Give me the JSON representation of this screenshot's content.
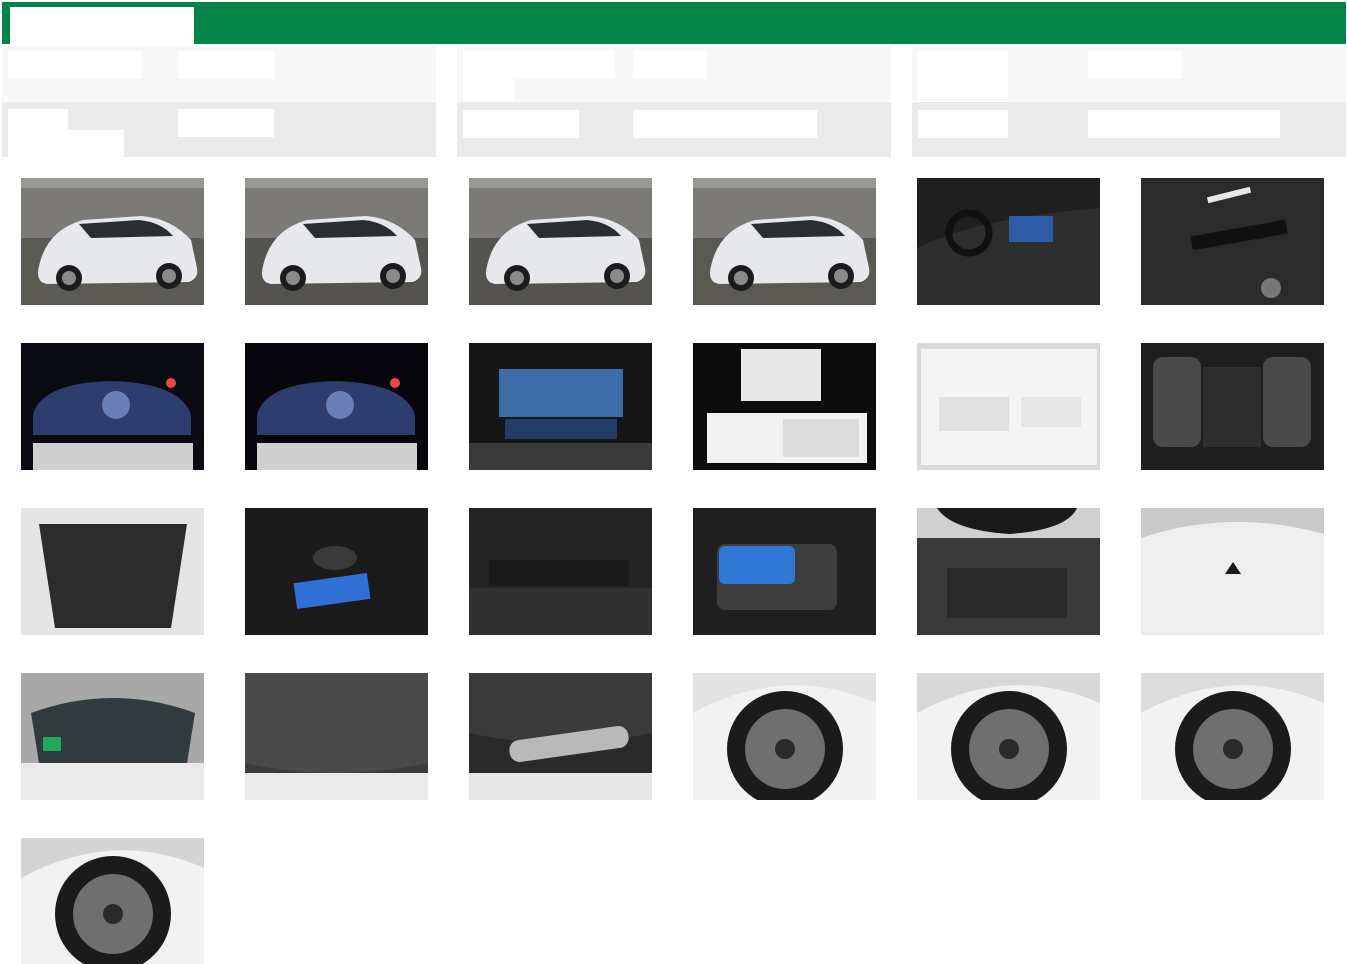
{
  "header": {
    "brand_color": "#028449",
    "tab_label": ""
  },
  "info_panels": [
    {
      "rows": [
        {
          "label": "",
          "value": ""
        },
        {
          "label": "",
          "value": ""
        }
      ]
    },
    {
      "rows": [
        {
          "label": "",
          "value": ""
        },
        {
          "label": "",
          "value": ""
        }
      ]
    },
    {
      "rows": [
        {
          "label": "",
          "value": ""
        },
        {
          "label": "",
          "value": ""
        }
      ]
    }
  ],
  "gallery": {
    "photos": [
      {
        "icon": "car-front-left-photo",
        "kind": "ext",
        "bg": "#5c5a55"
      },
      {
        "icon": "car-front-right-photo",
        "kind": "ext",
        "bg": "#55534f"
      },
      {
        "icon": "car-rear-left-photo",
        "kind": "ext",
        "bg": "#55534f"
      },
      {
        "icon": "car-rear-right-photo",
        "kind": "ext",
        "bg": "#5a5853"
      },
      {
        "icon": "dashboard-interior-photo",
        "kind": "interior",
        "bg": "#1f1f1f"
      },
      {
        "icon": "vin-plate-photo",
        "kind": "vin",
        "bg": "#2b2b2b"
      },
      {
        "icon": "instrument-cluster-photo",
        "kind": "cluster",
        "bg": "#0a0a12"
      },
      {
        "icon": "instrument-cluster-closeup-photo",
        "kind": "cluster",
        "bg": "#06060c"
      },
      {
        "icon": "infotainment-screen-photo",
        "kind": "screen",
        "bg": "#161616"
      },
      {
        "icon": "owner-manual-photo",
        "kind": "manual",
        "bg": "#0c0c0c"
      },
      {
        "icon": "service-book-photo",
        "kind": "book",
        "bg": "#d9d9d9"
      },
      {
        "icon": "rear-seats-photo",
        "kind": "seats",
        "bg": "#1e1e1e"
      },
      {
        "icon": "trunk-open-photo",
        "kind": "trunk",
        "bg": "#2d2d2d"
      },
      {
        "icon": "trunk-floor-repair-kit-photo",
        "kind": "trunkfloor",
        "bg": "#1b1b1b"
      },
      {
        "icon": "trunk-side-compartment-photo",
        "kind": "trunkside",
        "bg": "#242424"
      },
      {
        "icon": "charging-cable-bag-photo",
        "kind": "bag",
        "bg": "#1f1f1f"
      },
      {
        "icon": "engine-bay-photo",
        "kind": "engine",
        "bg": "#3a3a3a"
      },
      {
        "icon": "roof-antenna-photo",
        "kind": "roof",
        "bg": "#c9c9c9"
      },
      {
        "icon": "windshield-photo",
        "kind": "windshield",
        "bg": "#a8a8a8"
      },
      {
        "icon": "underbody-front-photo",
        "kind": "underbody",
        "bg": "#3c3c3c"
      },
      {
        "icon": "underbody-exhaust-photo",
        "kind": "exhaust",
        "bg": "#2a2a2a"
      },
      {
        "icon": "wheel-front-left-photo",
        "kind": "wheel",
        "bg": "#e2e2e2"
      },
      {
        "icon": "wheel-rear-left-photo",
        "kind": "wheel",
        "bg": "#d8d8d8"
      },
      {
        "icon": "wheel-rear-right-photo",
        "kind": "wheel",
        "bg": "#dcdcdc"
      },
      {
        "icon": "wheel-front-right-photo",
        "kind": "wheel",
        "bg": "#d4d4d4"
      }
    ]
  }
}
